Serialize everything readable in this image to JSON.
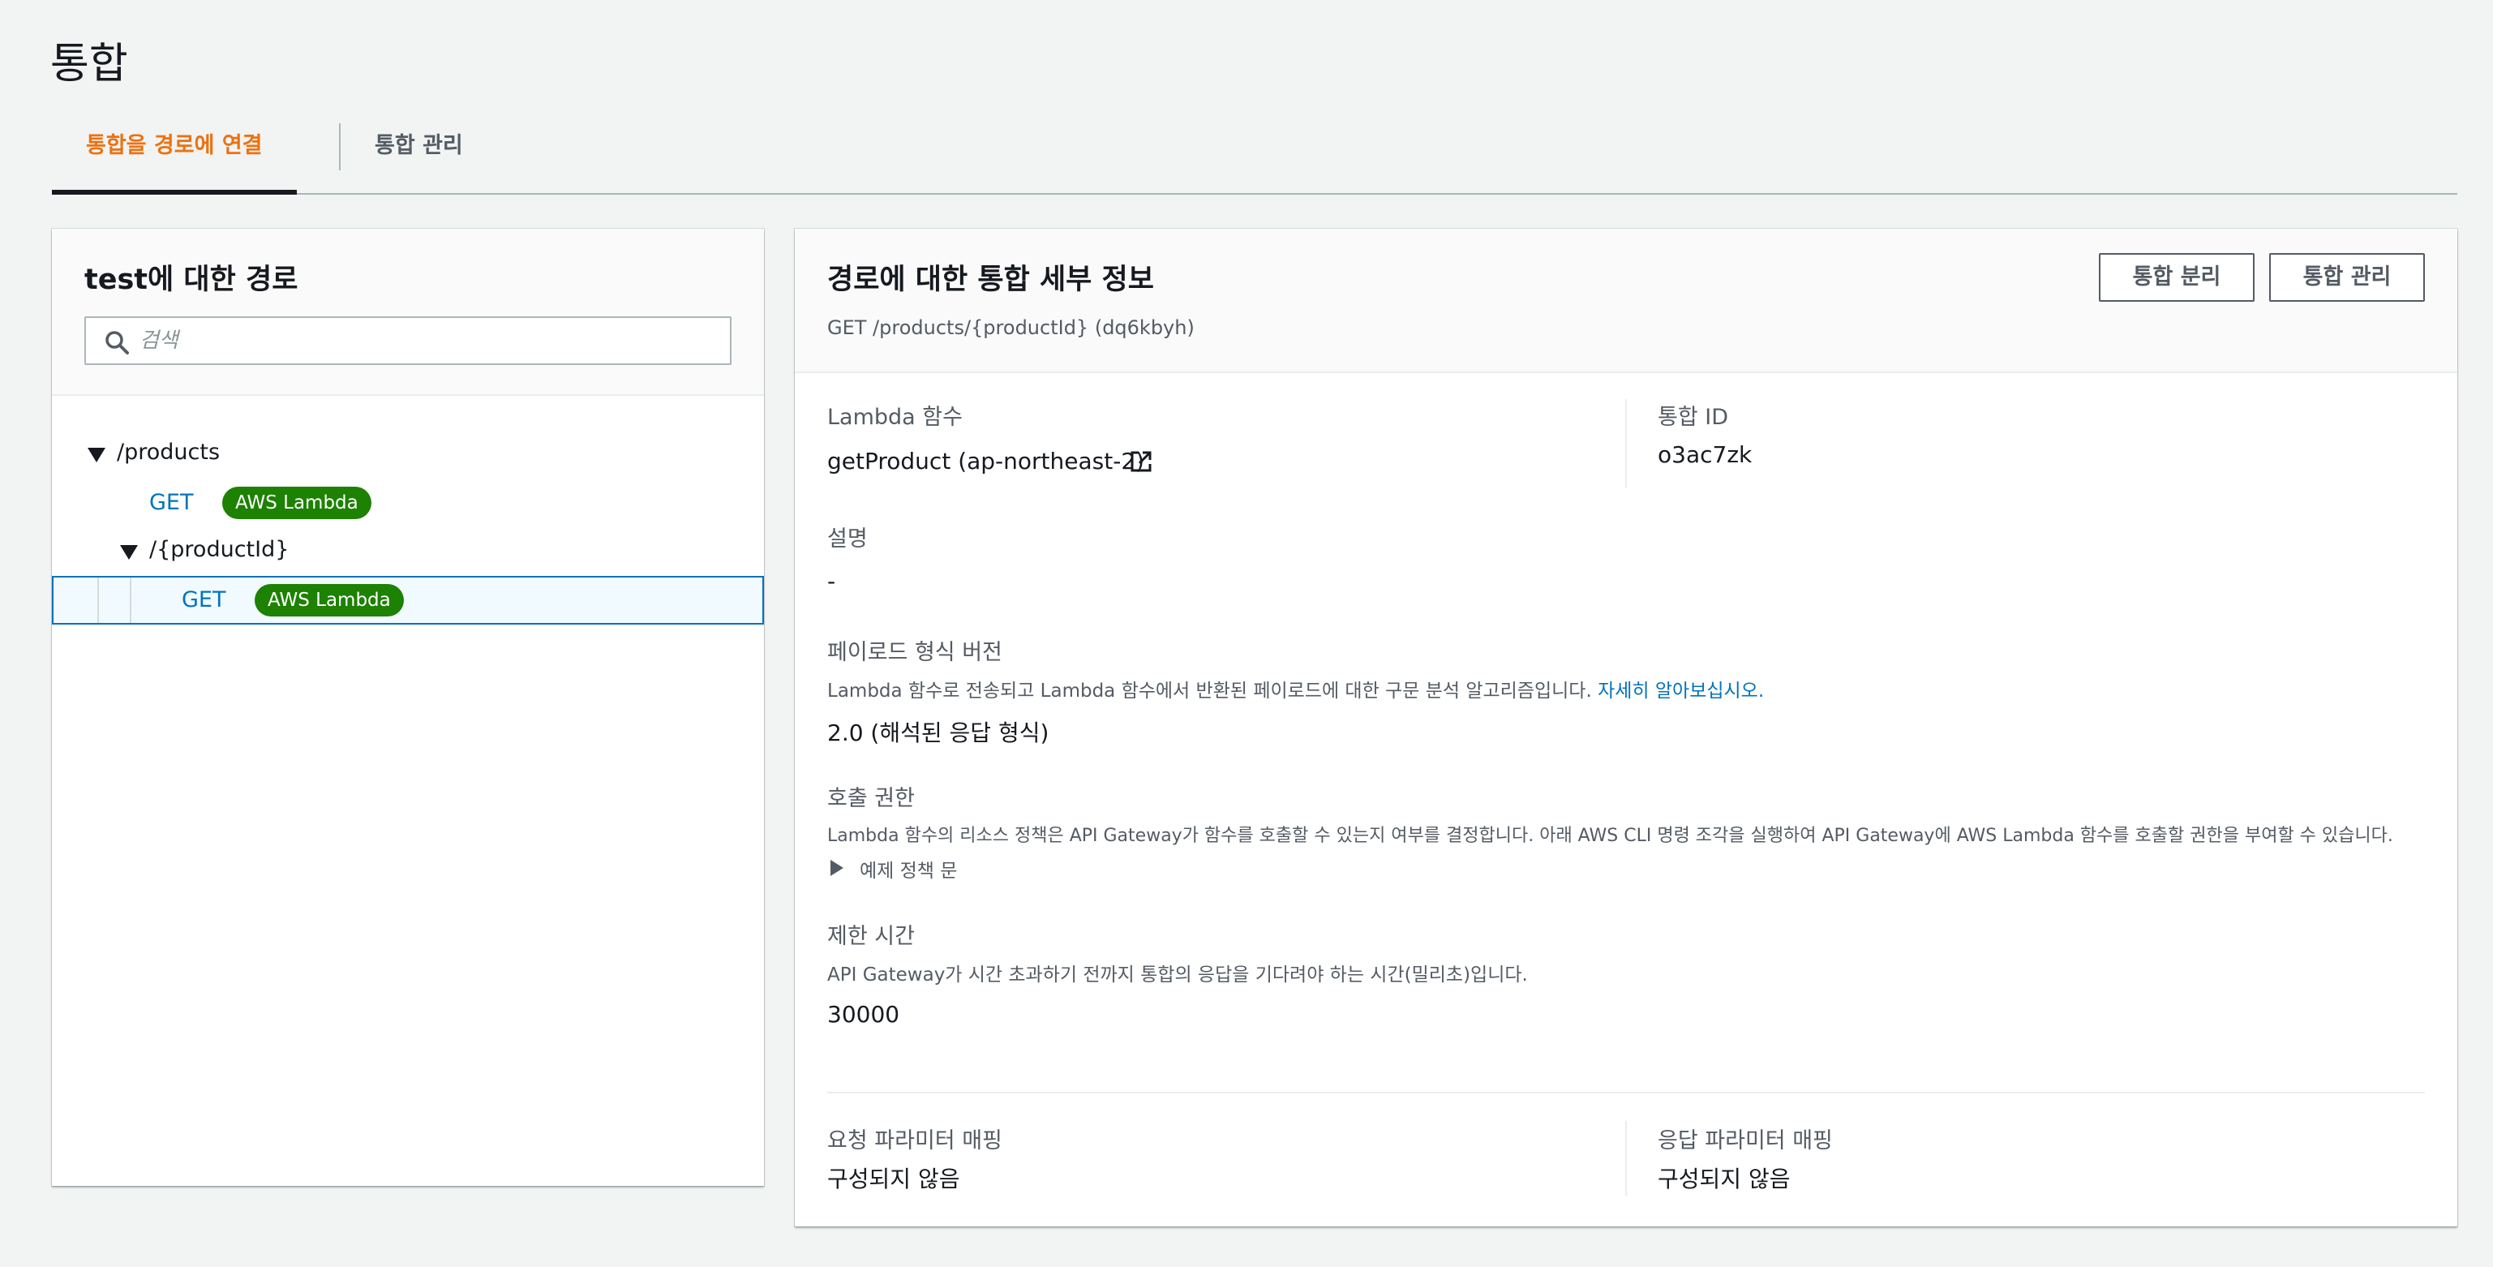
{
  "page": {
    "title": "통합"
  },
  "tabs": [
    {
      "label": "통합을 경로에 연결",
      "active": true
    },
    {
      "label": "통합 관리",
      "active": false
    }
  ],
  "routes_panel": {
    "title": "test에 대한 경로",
    "search_placeholder": "검색",
    "tree": {
      "products_path": "/products",
      "products_get": {
        "method": "GET",
        "badge": "AWS Lambda"
      },
      "product_id_path": "/{productId}",
      "product_id_get": {
        "method": "GET",
        "badge": "AWS Lambda"
      }
    }
  },
  "details_panel": {
    "title": "경로에 대한 통합 세부 정보",
    "subtitle": "GET /products/{productId} (dq6kbyh)",
    "buttons": {
      "detach": "통합 분리",
      "manage": "통합 관리"
    },
    "lambda_function": {
      "label": "Lambda 함수",
      "value": "getProduct (ap-northeast-2)"
    },
    "integration_id": {
      "label": "통합 ID",
      "value": "o3ac7zk"
    },
    "description": {
      "label": "설명",
      "value": "-"
    },
    "payload_version": {
      "label": "페이로드 형식 버전",
      "desc": "Lambda 함수로 전송되고 Lambda 함수에서 반환된 페이로드에 대한 구문 분석 알고리즘입니다.",
      "link": "자세히 알아보십시오.",
      "value": "2.0 (해석된 응답 형식)"
    },
    "invoke_permission": {
      "label": "호출 권한",
      "desc": "Lambda 함수의 리소스 정책은 API Gateway가 함수를 호출할 수 있는지 여부를 결정합니다. 아래 AWS CLI 명령 조각을 실행하여 API Gateway에 AWS Lambda 함수를 호출할 권한을 부여할 수 있습니다.",
      "expander": "예제 정책 문"
    },
    "timeout": {
      "label": "제한 시간",
      "desc": "API Gateway가 시간 초과하기 전까지 통합의 응답을 기다려야 하는 시간(밀리초)입니다.",
      "value": "30000"
    },
    "request_mapping": {
      "label": "요청 파라미터 매핑",
      "value": "구성되지 않음"
    },
    "response_mapping": {
      "label": "응답 파라미터 매핑",
      "value": "구성되지 않음"
    }
  },
  "colors": {
    "accent": "#ec7211",
    "link": "#0073bb",
    "badge": "#1d8102"
  }
}
